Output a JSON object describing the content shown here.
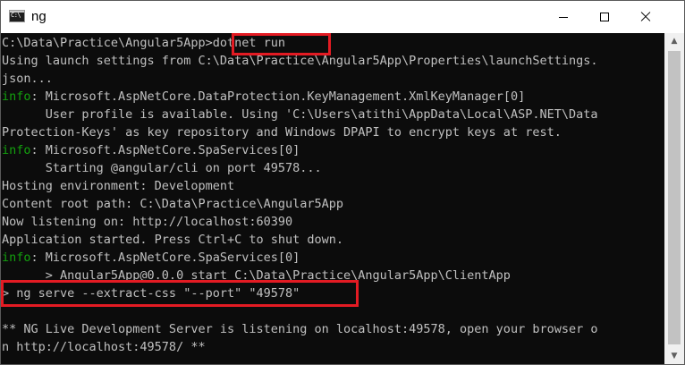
{
  "window": {
    "title": "ng",
    "icon": "cmd-icon"
  },
  "terminal": {
    "lines": [
      {
        "prefix": "",
        "text": "C:\\Data\\Practice\\Angular5App>dotnet run"
      },
      {
        "prefix": "",
        "text": "Using launch settings from C:\\Data\\Practice\\Angular5App\\Properties\\launchSettings."
      },
      {
        "prefix": "",
        "text": "json..."
      },
      {
        "prefix": "info",
        "text": ": Microsoft.AspNetCore.DataProtection.KeyManagement.XmlKeyManager[0]"
      },
      {
        "prefix": "",
        "text": "      User profile is available. Using 'C:\\Users\\atithi\\AppData\\Local\\ASP.NET\\Data"
      },
      {
        "prefix": "",
        "text": "Protection-Keys' as key repository and Windows DPAPI to encrypt keys at rest."
      },
      {
        "prefix": "info",
        "text": ": Microsoft.AspNetCore.SpaServices[0]"
      },
      {
        "prefix": "",
        "text": "      Starting @angular/cli on port 49578..."
      },
      {
        "prefix": "",
        "text": "Hosting environment: Development"
      },
      {
        "prefix": "",
        "text": "Content root path: C:\\Data\\Practice\\Angular5App"
      },
      {
        "prefix": "",
        "text": "Now listening on: http://localhost:60390"
      },
      {
        "prefix": "",
        "text": "Application started. Press Ctrl+C to shut down."
      },
      {
        "prefix": "info",
        "text": ": Microsoft.AspNetCore.SpaServices[0]"
      },
      {
        "prefix": "",
        "text": "      > Angular5App@0.0.0 start C:\\Data\\Practice\\Angular5App\\ClientApp"
      },
      {
        "prefix": "",
        "text": "> ng serve --extract-css \"--port\" \"49578\""
      },
      {
        "prefix": "",
        "text": ""
      },
      {
        "prefix": "",
        "text": "** NG Live Development Server is listening on localhost:49578, open your browser o"
      },
      {
        "prefix": "",
        "text": "n http://localhost:49578/ **"
      }
    ]
  },
  "colors": {
    "background": "#0c0c0c",
    "text": "#c0c0c0",
    "info": "#13a10e",
    "highlight": "#e31b23"
  }
}
